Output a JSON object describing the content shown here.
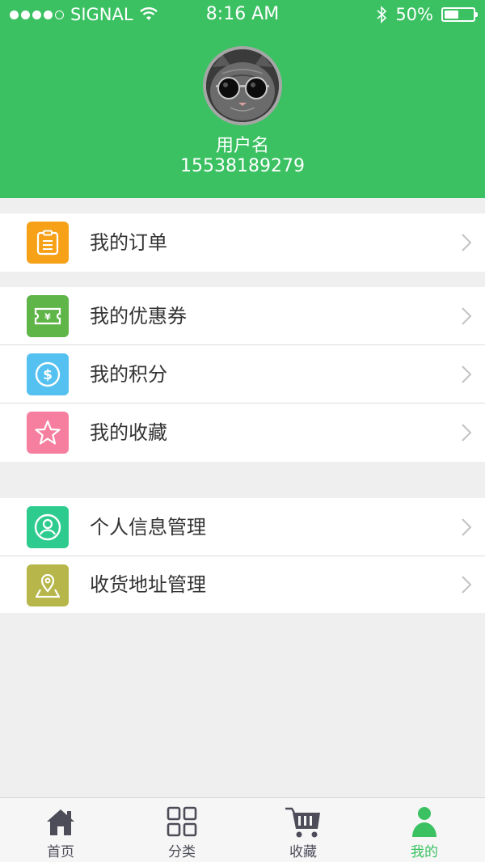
{
  "status_bar": {
    "carrier": "SIGNAL",
    "time": "8:16 AM",
    "battery": "50%",
    "battery_level": 0.5
  },
  "profile": {
    "username": "用户名",
    "phone": "15538189279"
  },
  "menu_groups": [
    {
      "items": [
        {
          "label": "我的订单",
          "icon": "clipboard-icon",
          "color": "#f6a118"
        }
      ]
    },
    {
      "items": [
        {
          "label": "我的优惠券",
          "icon": "coupon-icon",
          "color": "#5fb548"
        },
        {
          "label": "我的积分",
          "icon": "dollar-coin-icon",
          "color": "#55c1f0"
        },
        {
          "label": "我的收藏",
          "icon": "star-icon",
          "color": "#f67e9e"
        }
      ]
    },
    {
      "items": [
        {
          "label": "个人信息管理",
          "icon": "user-icon",
          "color": "#2ecb8f"
        },
        {
          "label": "收货地址管理",
          "icon": "location-pin-icon",
          "color": "#b6b64a"
        }
      ]
    }
  ],
  "tabbar": {
    "tabs": [
      {
        "label": "首页",
        "icon": "home-icon",
        "active": false
      },
      {
        "label": "分类",
        "icon": "grid-icon",
        "active": false
      },
      {
        "label": "收藏",
        "icon": "cart-icon",
        "active": false
      },
      {
        "label": "我的",
        "icon": "person-icon",
        "active": true
      }
    ],
    "active_color": "#3bc162",
    "inactive_color": "#4d4d5a"
  },
  "colors": {
    "brand_green": "#3bc162",
    "background": "#efefef"
  }
}
